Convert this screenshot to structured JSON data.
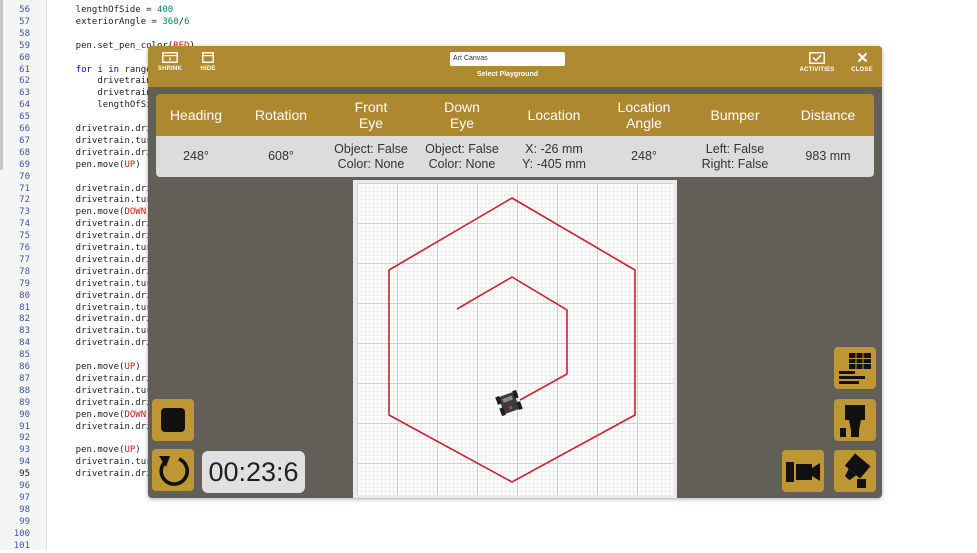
{
  "editor": {
    "lines": [
      {
        "n": "56",
        "segs": [
          {
            "t": "    lengthOfSide = "
          },
          {
            "t": "400",
            "c": "nm"
          }
        ]
      },
      {
        "n": "57",
        "segs": [
          {
            "t": "    exteriorAngle = "
          },
          {
            "t": "360",
            "c": "nm"
          },
          {
            "t": "/"
          },
          {
            "t": "6",
            "c": "nm"
          }
        ]
      },
      {
        "n": "58",
        "segs": []
      },
      {
        "n": "59",
        "segs": [
          {
            "t": "    pen.set_pen_color("
          },
          {
            "t": "RED",
            "c": "sr"
          },
          {
            "t": ")"
          }
        ]
      },
      {
        "n": "60",
        "segs": []
      },
      {
        "n": "61",
        "segs": [
          {
            "t": "    "
          },
          {
            "t": "for",
            "c": "kw"
          },
          {
            "t": " i "
          },
          {
            "t": "in",
            "c": "kw"
          },
          {
            "t": " range(nu"
          }
        ]
      },
      {
        "n": "62",
        "segs": [
          {
            "t": "        drivetrain.dr"
          }
        ]
      },
      {
        "n": "63",
        "segs": [
          {
            "t": "        drivetrain.tu"
          }
        ]
      },
      {
        "n": "64",
        "segs": [
          {
            "t": "        lengthOfSide "
          }
        ]
      },
      {
        "n": "65",
        "segs": []
      },
      {
        "n": "66",
        "segs": [
          {
            "t": "    drivetrain.drive_"
          }
        ]
      },
      {
        "n": "67",
        "segs": [
          {
            "t": "    drivetrain.turn_f"
          }
        ]
      },
      {
        "n": "68",
        "segs": [
          {
            "t": "    drivetrain.drive_"
          }
        ]
      },
      {
        "n": "69",
        "segs": [
          {
            "t": "    pen.move("
          },
          {
            "t": "UP",
            "c": "sr"
          },
          {
            "t": ")"
          }
        ]
      },
      {
        "n": "70",
        "segs": []
      },
      {
        "n": "71",
        "segs": [
          {
            "t": "    drivetrain.drive_"
          }
        ]
      },
      {
        "n": "72",
        "segs": [
          {
            "t": "    drivetrain.turn_f"
          }
        ]
      },
      {
        "n": "73",
        "segs": [
          {
            "t": "    pen.move("
          },
          {
            "t": "DOWN",
            "c": "sr"
          },
          {
            "t": ")"
          }
        ]
      },
      {
        "n": "74",
        "segs": [
          {
            "t": "    drivetrain.drive_"
          }
        ]
      },
      {
        "n": "75",
        "segs": [
          {
            "t": "    drivetrain.drive_"
          }
        ]
      },
      {
        "n": "76",
        "segs": [
          {
            "t": "    drivetrain.turn_f"
          }
        ]
      },
      {
        "n": "77",
        "segs": [
          {
            "t": "    drivetrain.drive_"
          }
        ]
      },
      {
        "n": "78",
        "segs": [
          {
            "t": "    drivetrain.drive_"
          }
        ]
      },
      {
        "n": "79",
        "segs": [
          {
            "t": "    drivetrain.turn_f"
          }
        ]
      },
      {
        "n": "80",
        "segs": [
          {
            "t": "    drivetrain.drive_"
          }
        ]
      },
      {
        "n": "81",
        "segs": [
          {
            "t": "    drivetrain.turn_f"
          }
        ]
      },
      {
        "n": "82",
        "segs": [
          {
            "t": "    drivetrain.drive_"
          }
        ]
      },
      {
        "n": "83",
        "segs": [
          {
            "t": "    drivetrain.turn_f"
          }
        ]
      },
      {
        "n": "84",
        "segs": [
          {
            "t": "    drivetrain.drive_"
          }
        ]
      },
      {
        "n": "85",
        "segs": []
      },
      {
        "n": "86",
        "segs": [
          {
            "t": "    pen.move("
          },
          {
            "t": "UP",
            "c": "sr"
          },
          {
            "t": ")"
          }
        ]
      },
      {
        "n": "87",
        "segs": [
          {
            "t": "    drivetrain.drive_"
          }
        ]
      },
      {
        "n": "88",
        "segs": [
          {
            "t": "    drivetrain.turn_f"
          }
        ]
      },
      {
        "n": "89",
        "segs": [
          {
            "t": "    drivetrain.drive_"
          }
        ]
      },
      {
        "n": "90",
        "segs": [
          {
            "t": "    pen.move("
          },
          {
            "t": "DOWN",
            "c": "sr"
          },
          {
            "t": ")"
          }
        ]
      },
      {
        "n": "91",
        "segs": [
          {
            "t": "    drivetrain.drive_"
          }
        ]
      },
      {
        "n": "92",
        "segs": []
      },
      {
        "n": "93",
        "segs": [
          {
            "t": "    pen.move("
          },
          {
            "t": "UP",
            "c": "sr"
          },
          {
            "t": ")"
          }
        ]
      },
      {
        "n": "94",
        "segs": [
          {
            "t": "    drivetrain.turn_f"
          }
        ]
      },
      {
        "n": "95",
        "segs": [
          {
            "t": "    drivetrain.drive_"
          }
        ],
        "current": true
      },
      {
        "n": "96",
        "segs": []
      },
      {
        "n": "97",
        "segs": []
      },
      {
        "n": "98",
        "segs": []
      },
      {
        "n": "99",
        "segs": []
      },
      {
        "n": "100",
        "segs": []
      },
      {
        "n": "101",
        "segs": []
      }
    ]
  },
  "playground": {
    "toolbar": {
      "shrink_label": "SHRINK",
      "hide_label": "HIDE",
      "activities_label": "ACTIVITIES",
      "close_label": "CLOSE",
      "select_value": "Art Canvas",
      "select_label": "Select Playground"
    },
    "sensors": {
      "headers": [
        "Heading",
        "Rotation",
        "Front\nEye",
        "Down\nEye",
        "Location",
        "Location\nAngle",
        "Bumper",
        "Distance"
      ],
      "values": [
        "248°",
        "608°",
        "Object: False\nColor: None",
        "Object: False\nColor: None",
        "X: -26 mm\nY: -405 mm",
        "248°",
        "Left: False\nRight: False",
        "983 mm"
      ]
    },
    "timer": "00:23:6",
    "colors": {
      "frame": "#625f58",
      "gold": "#b08a30",
      "pen": "#cc1f2d",
      "value_row": "#dcdcdc"
    }
  }
}
